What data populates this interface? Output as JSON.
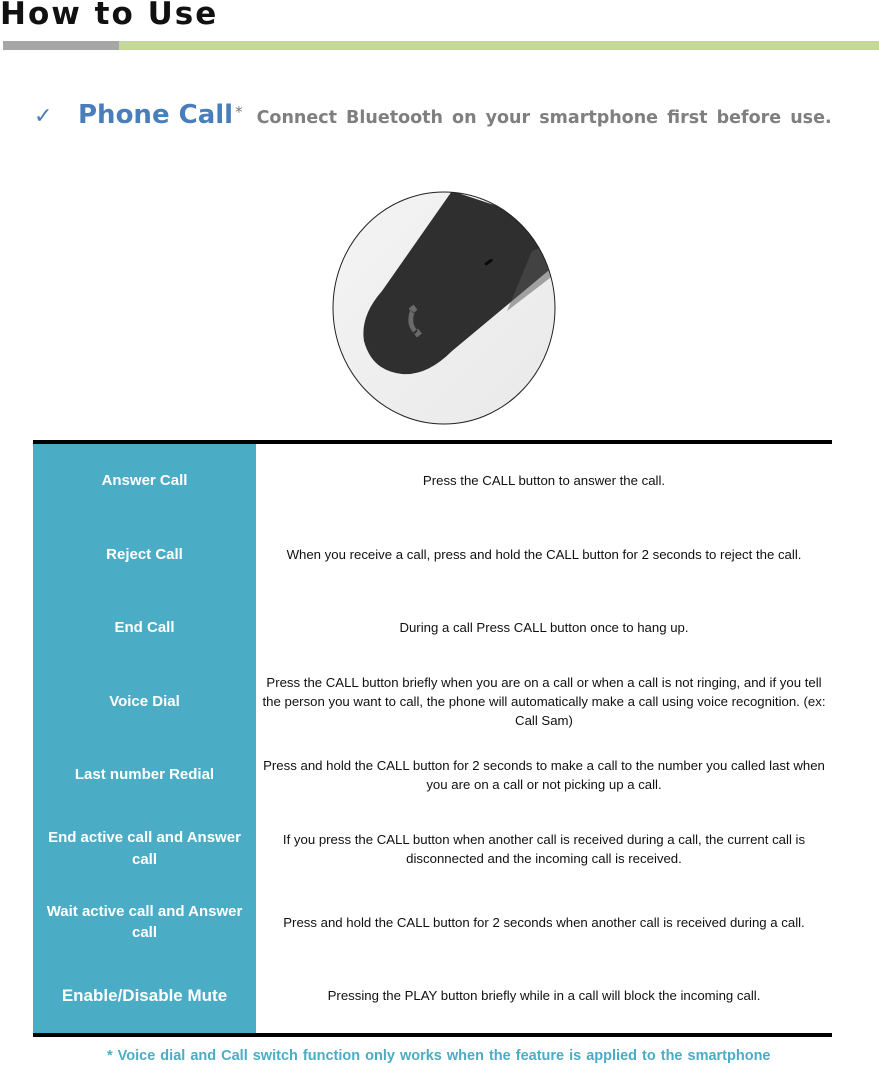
{
  "header": {
    "title": "How to Use",
    "bar_colors": {
      "gray": "#a6a6a6",
      "green": "#c5d89c"
    }
  },
  "section": {
    "check_icon": "check-icon",
    "title": "Phone Call",
    "asterisk": "*",
    "note": "Connect Bluetooth on your smartphone first before use."
  },
  "image": {
    "alt": "Close-up of headset CALL button",
    "icon": "phone-handset-icon"
  },
  "table": {
    "label_bg": "#4bacc6",
    "rows": [
      {
        "label": "Answer Call",
        "description": "Press the CALL button to answer the call."
      },
      {
        "label": "Reject Call",
        "description": "When you receive a call, press and hold the CALL button for 2 seconds to reject the call."
      },
      {
        "label": "End Call",
        "description": "During a call Press CALL button once to hang up."
      },
      {
        "label": "Voice Dial",
        "description": "Press the CALL button briefly when you are on a call or when a call is not ringing, and if you tell the person you want to call, the phone will automatically make a call using voice recognition. (ex: Call Sam)"
      },
      {
        "label": "Last number Redial",
        "description": "Press and hold the CALL button for 2 seconds to make a call to the number you called last when you are on a call or not picking up a call."
      },
      {
        "label": "End active call and Answer call",
        "description": "If you press the CALL button when another call is received during a call, the current call is disconnected and the incoming call is received."
      },
      {
        "label": "Wait active call and Answer call",
        "description": "Press and hold the CALL button for 2 seconds when another call is received during a call."
      },
      {
        "label": "Enable/Disable Mute",
        "description": "Pressing the PLAY button briefly while in a call will block the incoming call."
      }
    ]
  },
  "footnote": "* Voice dial and Call switch function only works when the feature is applied to the smartphone"
}
